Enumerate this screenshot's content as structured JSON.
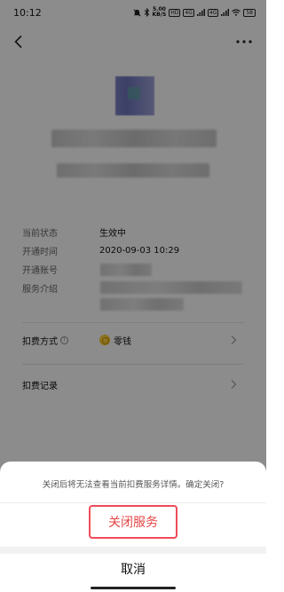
{
  "status_bar": {
    "time": "10:12",
    "net_speed_value": "5.00",
    "net_speed_unit": "KB/S",
    "hd_label": "HD",
    "signal_1": "4G",
    "signal_2": "4G",
    "battery": "58"
  },
  "detail": {
    "rows": [
      {
        "label": "当前状态",
        "value": "生效中"
      },
      {
        "label": "开通时间",
        "value": "2020-09-03 10:29"
      },
      {
        "label": "开通账号",
        "value": ""
      },
      {
        "label": "服务介绍",
        "value": ""
      }
    ],
    "pay_method": {
      "label": "扣费方式",
      "value": "零钱"
    },
    "records": {
      "label": "扣费记录"
    }
  },
  "sheet": {
    "message": "关闭后将无法查看当前扣费服务详情。确定关闭?",
    "confirm_label": "关闭服务",
    "cancel_label": "取消"
  },
  "colors": {
    "accent_red": "#e64545",
    "highlight_box": "#ef4b5a",
    "coin_yellow": "#f0b400"
  }
}
